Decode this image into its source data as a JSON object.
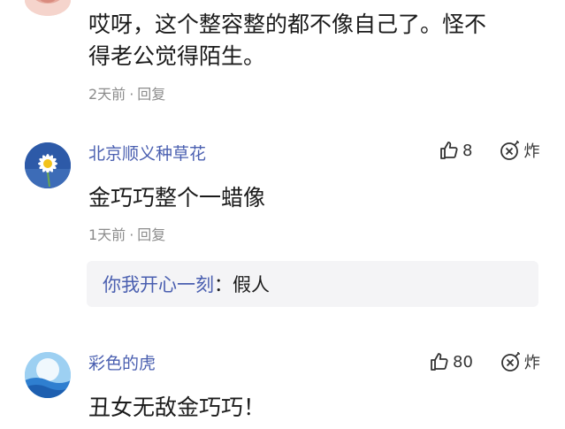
{
  "comments": [
    {
      "text_line1": "哎呀，这个整容整的都不像自己了。怪不",
      "text_line2": "得老公觉得陌生。",
      "time": "2天前",
      "reply_label": "回复"
    },
    {
      "name": "北京顺义种草花",
      "likes": "8",
      "react_label": "炸",
      "text": "金巧巧整个一蜡像",
      "time": "1天前",
      "reply_label": "回复",
      "reply": {
        "name": "你我开心一刻",
        "separator": "：",
        "text": "假人"
      }
    },
    {
      "name": "彩色的虎",
      "likes": "80",
      "react_label": "炸",
      "text": "丑女无敌金巧巧！"
    }
  ],
  "colors": {
    "username": "#4a5fb0",
    "meta": "#8c8c8c",
    "reply_bg": "#f4f4f6"
  }
}
